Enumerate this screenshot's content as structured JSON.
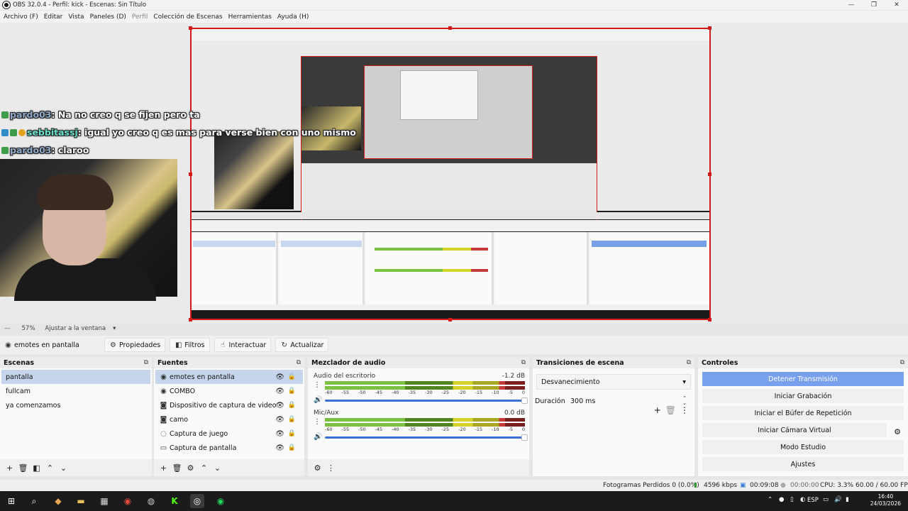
{
  "window": {
    "title": "OBS 32.0.4 - Perfil: kick - Escenas: Sin Título",
    "minimize": "—",
    "restore": "❐",
    "close": "✕"
  },
  "menu": {
    "items": [
      "Archivo (F)",
      "Editar",
      "Vista",
      "Paneles (D)",
      "Perfil",
      "Colección de Escenas",
      "Herramientas",
      "Ayuda (H)"
    ]
  },
  "chat": {
    "lines": [
      {
        "user": "pardo03",
        "text": ": Na no creo q se fijen pero ta"
      },
      {
        "user": "sebbitassj",
        "text": ": igual yo creo q es mas para verse bien con uno mismo"
      },
      {
        "user": "pardo03",
        "text": ": claroo"
      }
    ]
  },
  "zoom": {
    "level": "57%",
    "fit_label": "Ajustar a la ventana",
    "dropdown": "▾"
  },
  "source_toolbar": {
    "current_source": "emotes en pantalla",
    "properties": "Propiedades",
    "filters": "Filtros",
    "interact": "Interactuar",
    "refresh": "Actualizar"
  },
  "scenes": {
    "title": "Escenas",
    "items": [
      "pantalla",
      "fullcam",
      "ya comenzamos"
    ],
    "selected_index": 0
  },
  "sources": {
    "title": "Fuentes",
    "items": [
      {
        "label": "emotes en pantalla",
        "icon": "globe-icon"
      },
      {
        "label": "COMBO",
        "icon": "globe-icon"
      },
      {
        "label": "Dispositivo de captura de video",
        "icon": "camera-icon"
      },
      {
        "label": "camo",
        "icon": "camera-icon"
      },
      {
        "label": "Captura de juego",
        "icon": "gamepad-icon"
      },
      {
        "label": "Captura de pantalla",
        "icon": "monitor-icon"
      }
    ],
    "selected_index": 0
  },
  "mixer": {
    "title": "Mezclador de audio",
    "scale": [
      "-60",
      "-55",
      "-50",
      "-45",
      "-40",
      "-35",
      "-30",
      "-25",
      "-20",
      "-15",
      "-10",
      "-5",
      "0"
    ],
    "channels": [
      {
        "name": "Audio del escritorio",
        "db": "-1.2 dB",
        "volume_fraction": 1.0
      },
      {
        "name": "Mic/Aux",
        "db": "0.0 dB",
        "volume_fraction": 1.0
      }
    ]
  },
  "transitions": {
    "title": "Transiciones de escena",
    "selected": "Desvanecimiento",
    "duration_label": "Duración",
    "duration_value": "300 ms"
  },
  "controls": {
    "title": "Controles",
    "stop_stream": "Detener Transmisión",
    "start_recording": "Iniciar Grabación",
    "start_replay": "Iniciar el Búfer de Repetición",
    "start_virtualcam": "Iniciar Cámara Virtual",
    "studio_mode": "Modo Estudio",
    "settings": "Ajustes"
  },
  "status": {
    "dropped_frames": "Fotogramas Perdidos 0 (0.0%)",
    "bitrate": "4596 kbps",
    "stream_time": "00:09:08",
    "rec_time": "00:00:00",
    "cpu": "CPU: 3.3%",
    "fps": "60.00 / 60.00 FPS"
  },
  "taskbar": {
    "language": "ESP",
    "time": "16:40",
    "date": "24/03/2026"
  },
  "colors": {
    "accent": "#78a0ec",
    "selection": "#c7d5ec",
    "preview_border": "#d11a1a",
    "taskbar": "#1b1b1b"
  }
}
